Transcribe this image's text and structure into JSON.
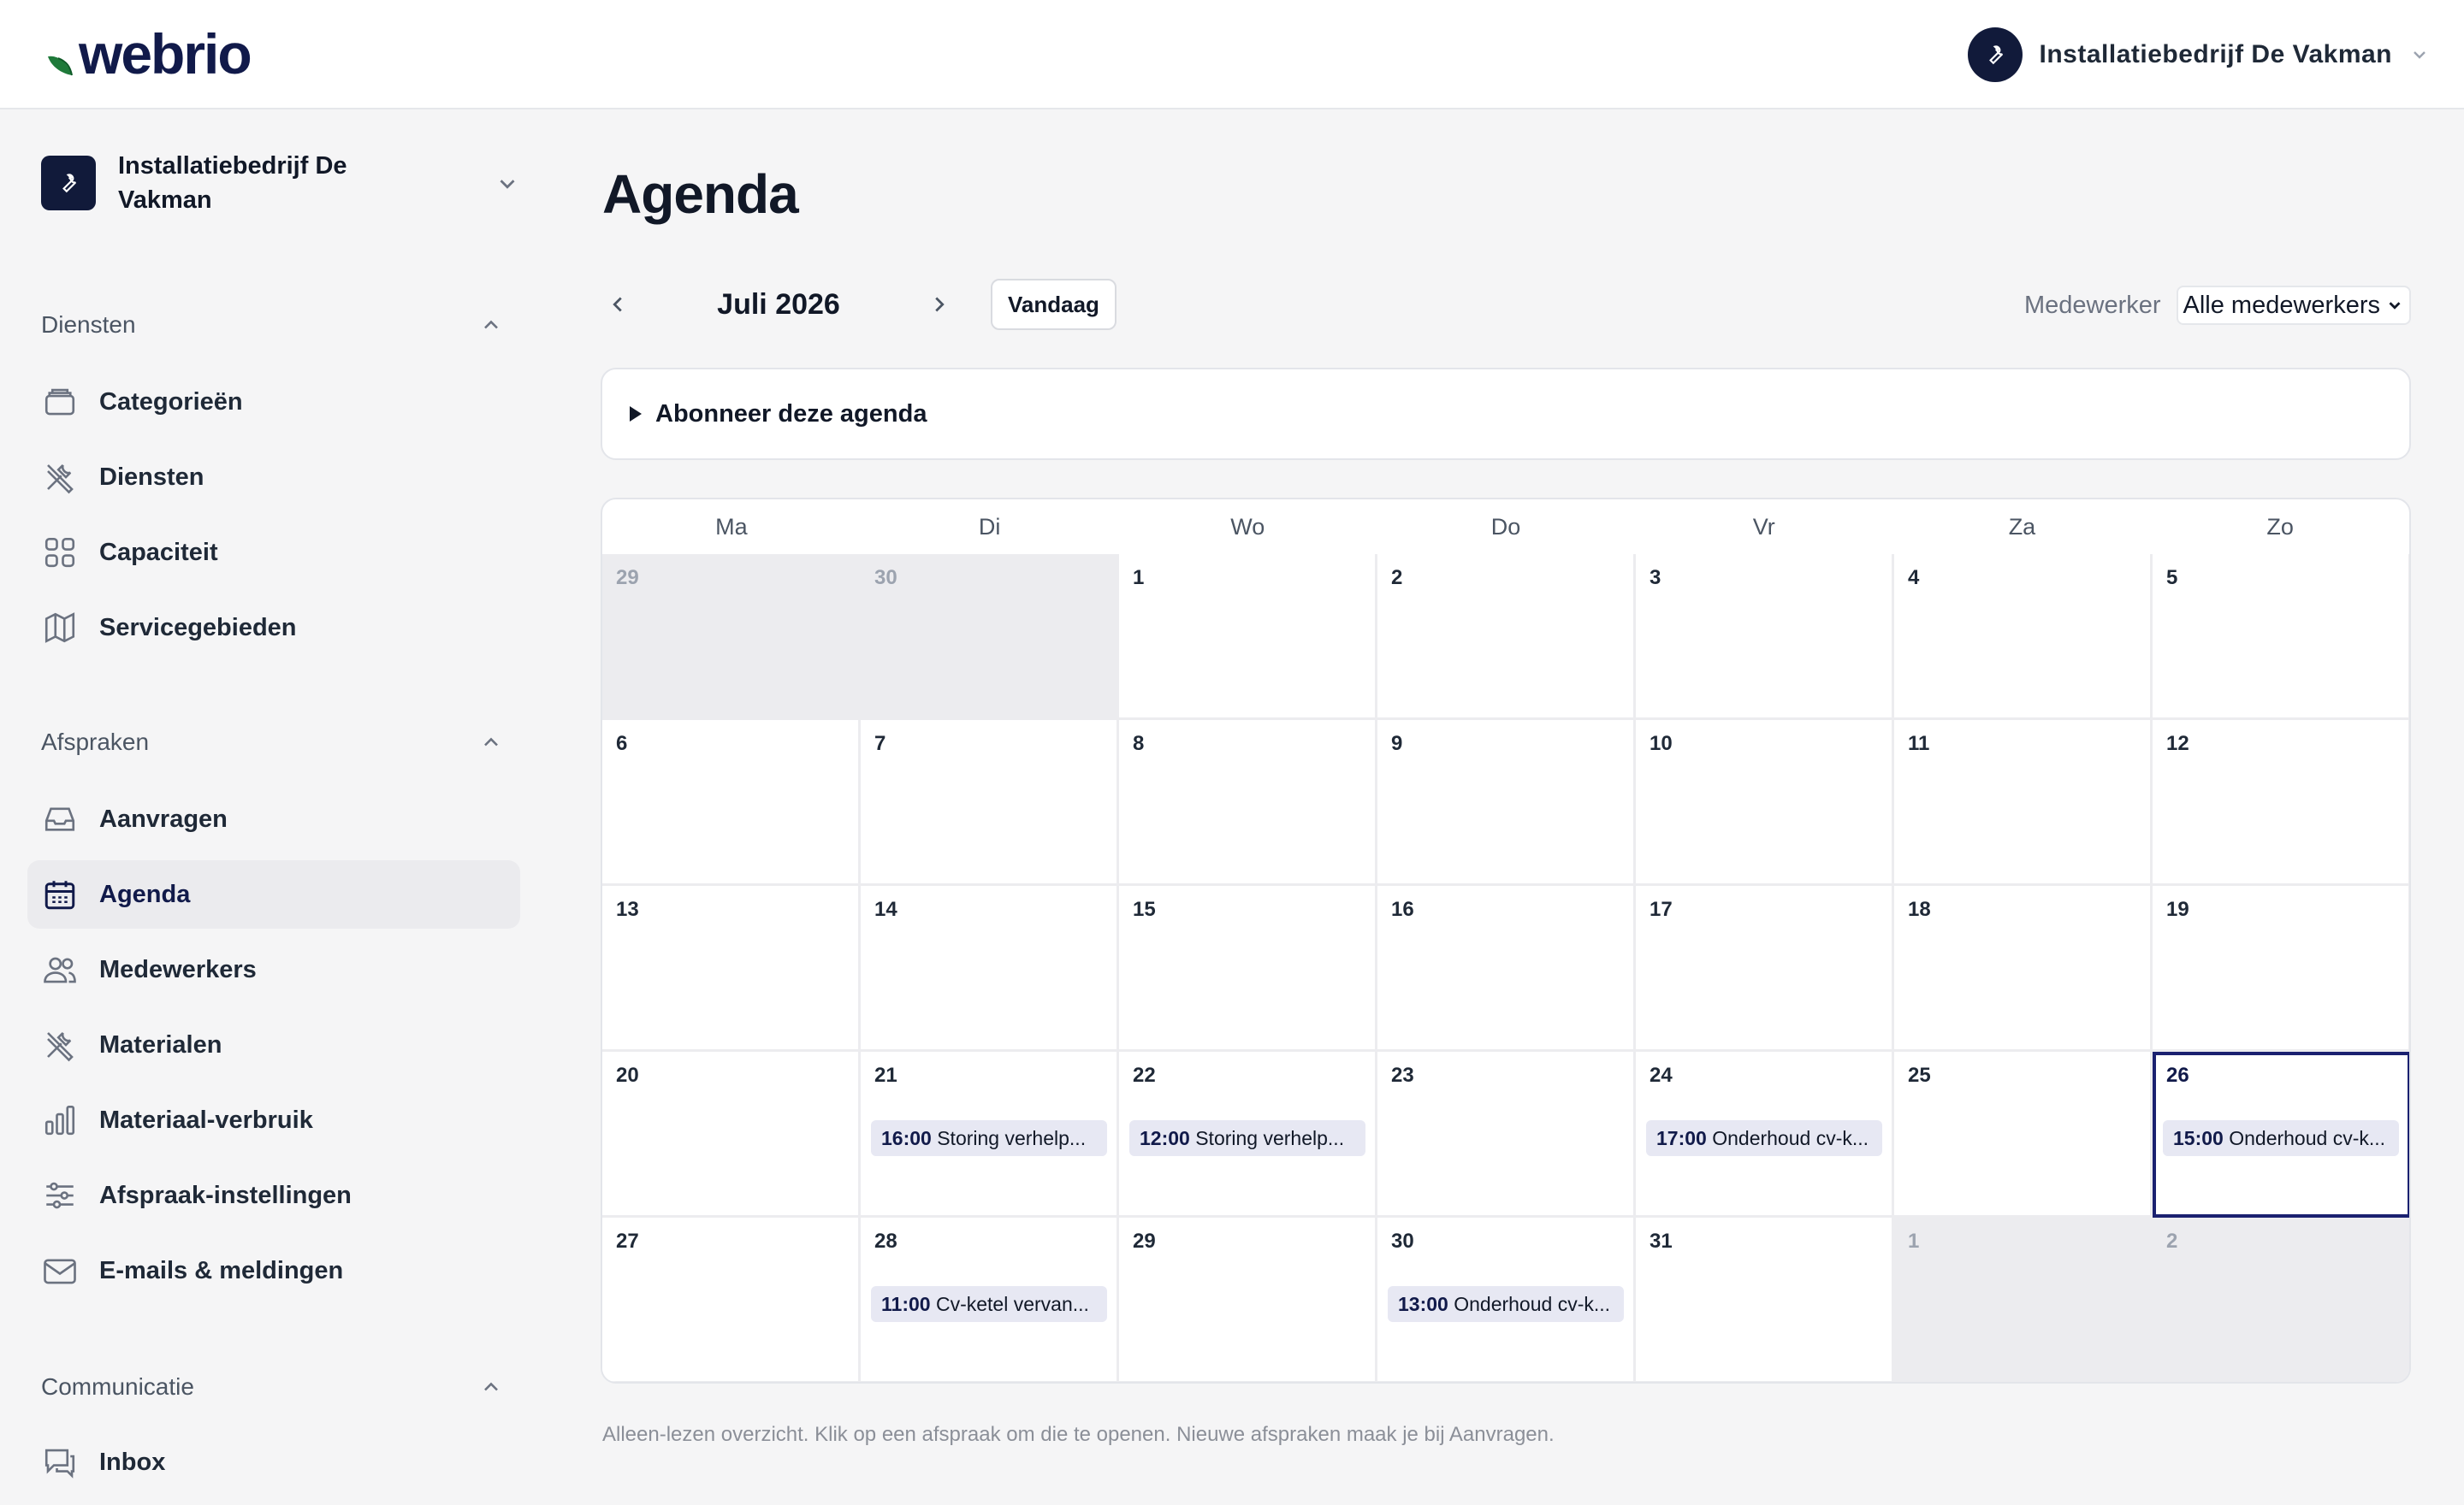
{
  "brand": {
    "logo_text": "webrio"
  },
  "header": {
    "account_name": "Installatiebedrijf De Vakman"
  },
  "sidebar": {
    "org_name": "Installatiebedrijf De Vakman",
    "sections": [
      {
        "title": "Diensten",
        "items": [
          {
            "label": "Categorieën",
            "icon": "folder-icon"
          },
          {
            "label": "Diensten",
            "icon": "tools-icon"
          },
          {
            "label": "Capaciteit",
            "icon": "grid-icon"
          },
          {
            "label": "Servicegebieden",
            "icon": "map-icon"
          }
        ]
      },
      {
        "title": "Afspraken",
        "items": [
          {
            "label": "Aanvragen",
            "icon": "inbox-icon"
          },
          {
            "label": "Agenda",
            "icon": "calendar-icon",
            "active": true
          },
          {
            "label": "Medewerkers",
            "icon": "users-icon"
          },
          {
            "label": "Materialen",
            "icon": "tools-icon"
          },
          {
            "label": "Materiaal-verbruik",
            "icon": "bar-chart-icon"
          },
          {
            "label": "Afspraak-instellingen",
            "icon": "sliders-icon"
          },
          {
            "label": "E-mails & meldingen",
            "icon": "mail-icon"
          }
        ]
      },
      {
        "title": "Communicatie",
        "items": [
          {
            "label": "Inbox",
            "icon": "chat-icon"
          }
        ]
      }
    ]
  },
  "main": {
    "title": "Agenda",
    "month_label": "Juli 2026",
    "today_label": "Vandaag",
    "filter_label": "Medewerker",
    "filter_value": "Alle medewerkers",
    "subscribe_label": "Abonneer deze agenda",
    "weekdays": [
      "Ma",
      "Di",
      "Wo",
      "Do",
      "Vr",
      "Za",
      "Zo"
    ],
    "footnote": "Alleen-lezen overzicht. Klik op een afspraak om die te openen. Nieuwe afspraken maak je bij Aanvragen."
  },
  "calendar": {
    "weeks": [
      [
        {
          "day": "29",
          "other": true
        },
        {
          "day": "30",
          "other": true
        },
        {
          "day": "1"
        },
        {
          "day": "2"
        },
        {
          "day": "3"
        },
        {
          "day": "4"
        },
        {
          "day": "5"
        }
      ],
      [
        {
          "day": "6"
        },
        {
          "day": "7"
        },
        {
          "day": "8"
        },
        {
          "day": "9"
        },
        {
          "day": "10"
        },
        {
          "day": "11"
        },
        {
          "day": "12"
        }
      ],
      [
        {
          "day": "13"
        },
        {
          "day": "14"
        },
        {
          "day": "15"
        },
        {
          "day": "16"
        },
        {
          "day": "17"
        },
        {
          "day": "18"
        },
        {
          "day": "19"
        }
      ],
      [
        {
          "day": "20"
        },
        {
          "day": "21",
          "event": {
            "time": "16:00",
            "title": "Storing verhelp..."
          }
        },
        {
          "day": "22",
          "event": {
            "time": "12:00",
            "title": "Storing verhelp..."
          }
        },
        {
          "day": "23"
        },
        {
          "day": "24",
          "event": {
            "time": "17:00",
            "title": "Onderhoud cv-k..."
          }
        },
        {
          "day": "25"
        },
        {
          "day": "26",
          "today": true,
          "event": {
            "time": "15:00",
            "title": "Onderhoud cv-k..."
          }
        }
      ],
      [
        {
          "day": "27"
        },
        {
          "day": "28",
          "event": {
            "time": "11:00",
            "title": "Cv-ketel vervan..."
          }
        },
        {
          "day": "29"
        },
        {
          "day": "30",
          "event": {
            "time": "13:00",
            "title": "Onderhoud cv-k..."
          }
        },
        {
          "day": "31"
        },
        {
          "day": "1",
          "other": true
        },
        {
          "day": "2",
          "other": true
        }
      ]
    ]
  },
  "colors": {
    "brand_navy": "#111a3a",
    "today_border": "#1a2170",
    "event_bg": "#e7e8f3",
    "leaf_green": "#1f7a3a"
  }
}
